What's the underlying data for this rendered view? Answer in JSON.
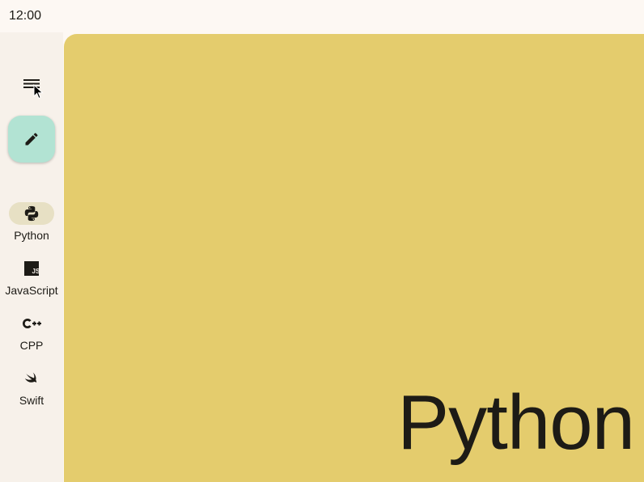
{
  "status_bar": {
    "time": "12:00"
  },
  "nav_rail": {
    "menu_icon": "menu-icon",
    "fab_icon": "edit-icon",
    "active_index": 0,
    "items": [
      {
        "label": "Python",
        "icon": "python-icon"
      },
      {
        "label": "JavaScript",
        "icon": "javascript-icon"
      },
      {
        "label": "CPP",
        "icon": "cpp-icon"
      },
      {
        "label": "Swift",
        "icon": "swift-icon"
      }
    ]
  },
  "content": {
    "title": "Python"
  },
  "colors": {
    "background": "#fdf8f3",
    "rail_background": "#f7f1ea",
    "fab_background": "#b2e3d3",
    "active_indicator": "#e7e0c4",
    "content_background": "#e4cc6d",
    "text": "#1d1b16"
  }
}
